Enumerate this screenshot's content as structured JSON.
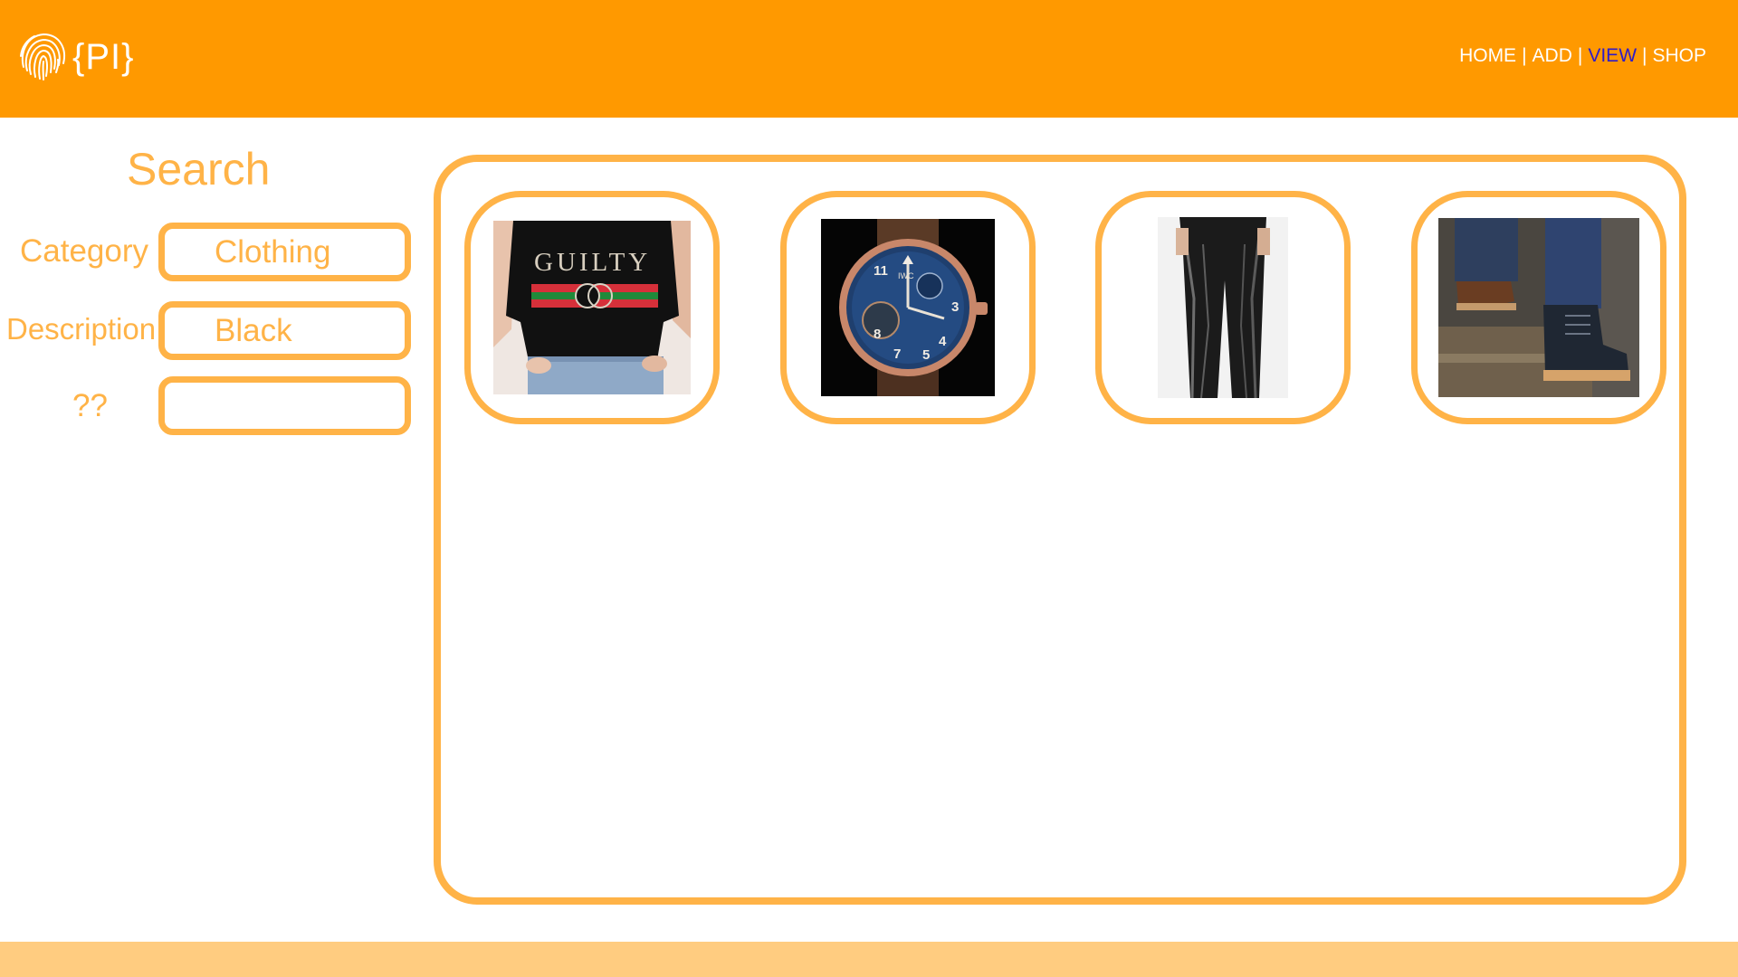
{
  "header": {
    "logo_text": "{PI}",
    "nav": [
      {
        "label": "HOME",
        "active": false
      },
      {
        "label": "ADD",
        "active": false
      },
      {
        "label": "VIEW",
        "active": true
      },
      {
        "label": "SHOP",
        "active": false
      }
    ],
    "separator": "|"
  },
  "search": {
    "title": "Search",
    "fields": [
      {
        "label": "Category",
        "value": "Clothing"
      },
      {
        "label": "Description",
        "value": "Black"
      },
      {
        "label": "??",
        "value": ""
      }
    ]
  },
  "results": {
    "items": [
      {
        "name": "black-guilty-tshirt",
        "print_text": "GUILTY"
      },
      {
        "name": "iwc-watch",
        "brand_text": "IWC"
      },
      {
        "name": "black-leather-pants"
      },
      {
        "name": "leather-boots"
      }
    ]
  },
  "colors": {
    "header": "#ff9900",
    "accent": "#ffb347",
    "footer": "#ffcc80",
    "nav_active": "#2f1cc8"
  }
}
